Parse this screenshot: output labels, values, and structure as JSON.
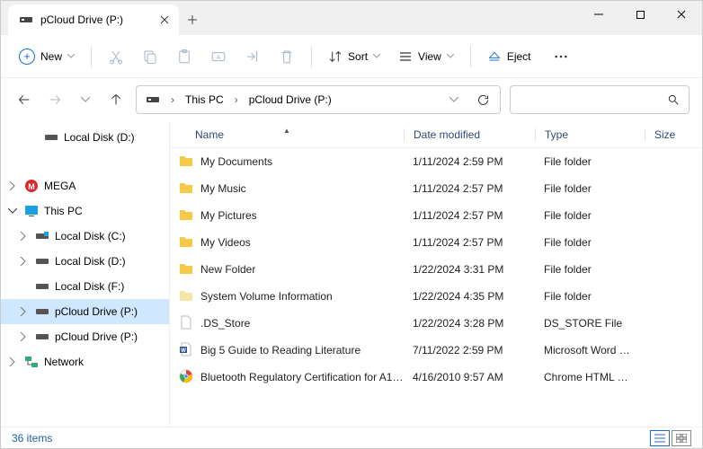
{
  "tab": {
    "title": "pCloud Drive (P:)"
  },
  "toolbar": {
    "new": "New",
    "sort": "Sort",
    "view": "View",
    "eject": "Eject"
  },
  "breadcrumb": {
    "seg0": "This PC",
    "seg1": "pCloud Drive (P:)"
  },
  "tree": {
    "localDiskD_top": "Local Disk (D:)",
    "mega": "MEGA",
    "thisPC": "This PC",
    "localDiskC": "Local Disk (C:)",
    "localDiskD": "Local Disk (D:)",
    "localDiskF": "Local Disk (F:)",
    "pcloud1": "pCloud Drive (P:)",
    "pcloud2": "pCloud Drive (P:)",
    "network": "Network"
  },
  "cols": {
    "name": "Name",
    "date": "Date modified",
    "type": "Type",
    "size": "Size"
  },
  "rows": [
    {
      "name": "My Documents",
      "date": "1/11/2024 2:59 PM",
      "type": "File folder",
      "icon": "folder"
    },
    {
      "name": "My Music",
      "date": "1/11/2024 2:57 PM",
      "type": "File folder",
      "icon": "folder"
    },
    {
      "name": "My Pictures",
      "date": "1/11/2024 2:57 PM",
      "type": "File folder",
      "icon": "folder"
    },
    {
      "name": "My Videos",
      "date": "1/11/2024 2:57 PM",
      "type": "File folder",
      "icon": "folder"
    },
    {
      "name": "New Folder",
      "date": "1/22/2024 3:31 PM",
      "type": "File folder",
      "icon": "folder"
    },
    {
      "name": "System Volume Information",
      "date": "1/22/2024 4:35 PM",
      "type": "File folder",
      "icon": "folder-light"
    },
    {
      "name": ".DS_Store",
      "date": "1/22/2024 3:28 PM",
      "type": "DS_STORE File",
      "icon": "file"
    },
    {
      "name": "Big 5 Guide to Reading Literature",
      "date": "7/11/2022 2:59 PM",
      "type": "Microsoft Word D…",
      "icon": "word"
    },
    {
      "name": "Bluetooth Regulatory Certification for A1…",
      "date": "4/16/2010 9:57 AM",
      "type": "Chrome HTML Do…",
      "icon": "chrome"
    }
  ],
  "status": {
    "count": "36 items"
  }
}
